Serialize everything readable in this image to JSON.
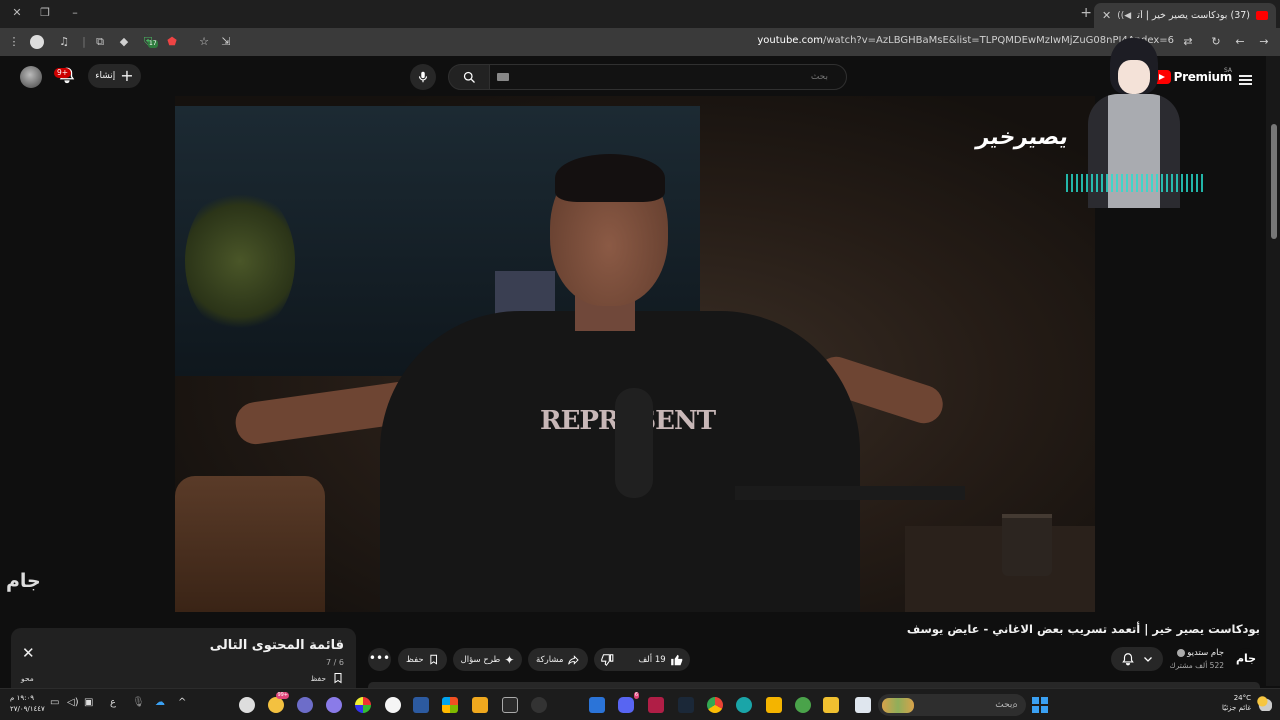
{
  "browser": {
    "tab_title": "(37) بودكاست يصير خير | أتعـ",
    "tab_close": "✕",
    "new_tab": "+",
    "url_host": "youtube.com",
    "url_path": "/watch?v=AzLBGHBaMsE&list=TLPQMDEwMzIwMjZuG08nPI4A",
    "url_tail": "ndex=6",
    "ext_badge": "17"
  },
  "masthead": {
    "notif_count": "9+",
    "create_label": "إنشاء",
    "search_placeholder": "بحث",
    "logo_word": "Premium",
    "country_code": "SA"
  },
  "video": {
    "shirt_print": "REPRESENT",
    "watermark": "يصيرخير",
    "corner_mark": "جام"
  },
  "info": {
    "title": "بودكاست يصير خير | أتعمد تسريب بعض الاغاني - عايض يوسف",
    "channel_avatar": "جام",
    "channel_name": "جام ستديو",
    "subscribers": "522 ألف مشترك",
    "likes": "19 ألف",
    "share": "مشاركة",
    "ask": "طرح سؤال",
    "save": "حفظ",
    "more": "•••"
  },
  "upnext": {
    "title": "قائمة المحتوى التالى",
    "count": "7 / 6",
    "close": "✕",
    "save_label": "حفظ",
    "owner": "محو"
  },
  "taskbar": {
    "temperature": "24°C",
    "weather_desc": "غائم جزئيًا",
    "search_text": "بحث",
    "lang": "ع",
    "time": "١٩:٠٩ م",
    "date": "٢٧/٠٩/١٤٤٧",
    "badge_chrome": "99+",
    "badge_discord": "6"
  }
}
